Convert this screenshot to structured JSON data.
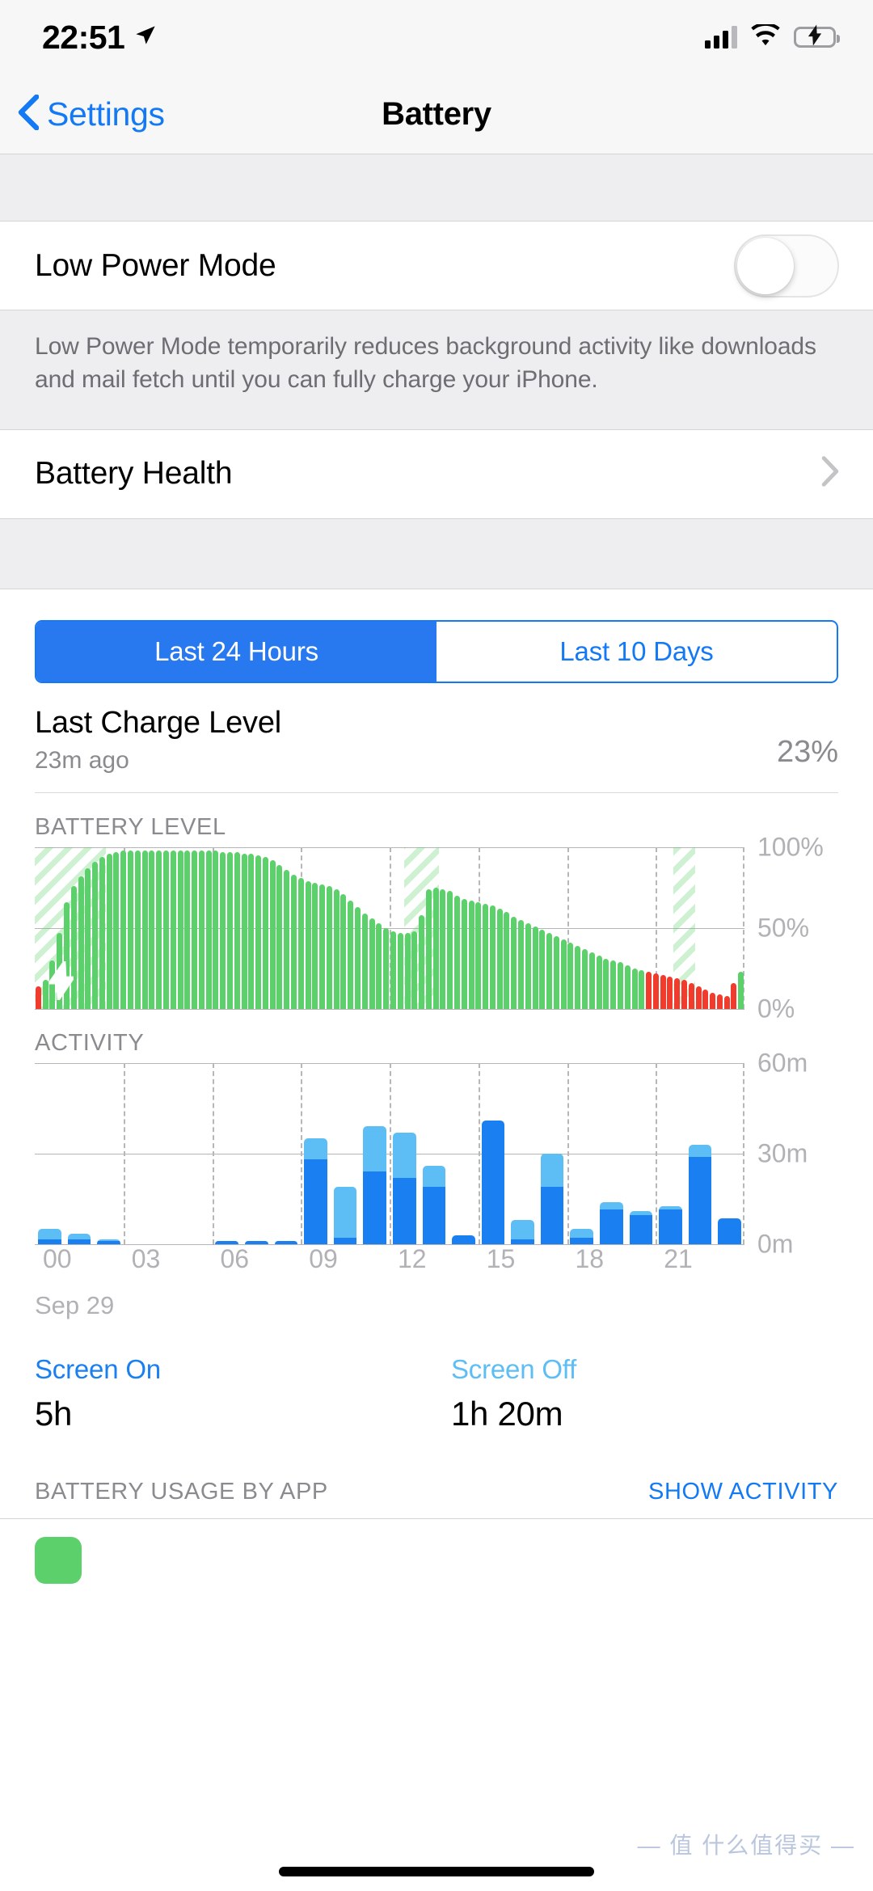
{
  "status_bar": {
    "time": "22:51",
    "location_icon": "location-arrow-icon",
    "cellular_icon": "cellular-bars-icon",
    "wifi_icon": "wifi-icon",
    "battery_icon": "battery-charging-icon"
  },
  "nav": {
    "back_label": "Settings",
    "back_icon": "chevron-left-icon",
    "title": "Battery"
  },
  "low_power": {
    "label": "Low Power Mode",
    "toggle_state": "off",
    "footer": "Low Power Mode temporarily reduces background activity like downloads and mail fetch until you can fully charge your iPhone."
  },
  "battery_health": {
    "label": "Battery Health",
    "disclosure_icon": "chevron-right-icon"
  },
  "segmented": {
    "options": [
      "Last 24 Hours",
      "Last 10 Days"
    ],
    "selected_index": 0
  },
  "last_charge": {
    "title": "Last Charge Level",
    "subtitle": "23m ago",
    "percent": "23%"
  },
  "legend": {
    "screen_on_label": "Screen On",
    "screen_on_value": "5h",
    "screen_off_label": "Screen Off",
    "screen_off_value": "1h 20m"
  },
  "bottom": {
    "usage_title": "BATTERY USAGE BY APP",
    "show_activity": "SHOW ACTIVITY"
  },
  "watermark": "— 值 什么值得买 —",
  "colors": {
    "accent_blue": "#1379f4",
    "segment_blue": "#2878f0",
    "battery_green": "#5cd06a",
    "battery_red": "#f03b2d",
    "screen_on_blue": "#1a7ff0",
    "screen_off_blue": "#5dbdf5",
    "grey_text": "#8a8a8f",
    "axis_label": "#b2b2b6"
  },
  "chart_data": [
    {
      "type": "bar",
      "name": "battery-level-chart",
      "title": "BATTERY LEVEL",
      "xlabel": "",
      "ylabel": "",
      "ylim": [
        0,
        100
      ],
      "ytick_labels": [
        "100%",
        "50%",
        "0%"
      ],
      "ytick_values": [
        100,
        50,
        0
      ],
      "grid": true,
      "x_range_hours": [
        0,
        24
      ],
      "charging_bands": [
        {
          "start_index": 0,
          "end_index": 9
        },
        {
          "start_index": 52,
          "end_index": 56
        },
        {
          "start_index": 90,
          "end_index": 92
        }
      ],
      "charging_bolt_index": 2,
      "bar_colors": {
        "normal": "#5cd06a",
        "low": "#f03b2d"
      },
      "values": [
        14,
        18,
        30,
        47,
        66,
        76,
        82,
        87,
        91,
        94,
        96,
        97,
        98,
        98,
        98,
        98,
        98,
        98,
        98,
        98,
        98,
        98,
        98,
        98,
        98,
        98,
        97,
        97,
        97,
        96,
        96,
        95,
        94,
        92,
        89,
        86,
        83,
        81,
        79,
        78,
        77,
        76,
        74,
        71,
        67,
        63,
        59,
        56,
        53,
        50,
        48,
        47,
        47,
        48,
        58,
        74,
        75,
        74,
        73,
        70,
        68,
        67,
        66,
        65,
        64,
        62,
        60,
        57,
        55,
        53,
        51,
        49,
        47,
        45,
        43,
        41,
        39,
        37,
        35,
        33,
        31,
        30,
        29,
        27,
        25,
        24,
        23,
        22,
        21,
        20,
        19,
        18,
        16,
        14,
        12,
        10,
        9,
        8,
        16,
        23
      ],
      "low_indices": [
        0,
        86,
        87,
        88,
        89,
        90,
        91,
        92,
        93,
        94,
        95,
        96,
        97,
        98
      ]
    },
    {
      "type": "bar",
      "name": "activity-chart",
      "title": "ACTIVITY",
      "stacked": true,
      "xlabel": "",
      "ylabel": "",
      "ylim": [
        0,
        60
      ],
      "ytick_labels": [
        "60m",
        "30m",
        "0m"
      ],
      "ytick_values": [
        60,
        30,
        0
      ],
      "grid": true,
      "date_label": "Sep 29",
      "xtick_labels": [
        "00",
        "03",
        "06",
        "09",
        "12",
        "15",
        "18",
        "21"
      ],
      "xtick_hours": [
        0,
        3,
        6,
        9,
        12,
        15,
        18,
        21
      ],
      "series": [
        {
          "name": "Screen On",
          "color": "#1a7ff0",
          "values": [
            1.5,
            1.5,
            1,
            0,
            0,
            0,
            1,
            1,
            1,
            28,
            2,
            24,
            22,
            19,
            3,
            41,
            1.5,
            19,
            2,
            11.5,
            9.5,
            11.5,
            29,
            8.5
          ]
        },
        {
          "name": "Screen Off",
          "color": "#5dbdf5",
          "values": [
            3.5,
            2,
            0.5,
            0,
            0,
            0,
            0,
            0,
            0,
            7,
            17,
            15,
            15,
            7,
            0,
            0,
            6.5,
            11,
            3,
            2.5,
            1.5,
            1,
            4,
            0
          ]
        }
      ],
      "hours": [
        0,
        1,
        2,
        3,
        4,
        5,
        6,
        7,
        8,
        9,
        10,
        11,
        12,
        13,
        14,
        15,
        16,
        17,
        18,
        19,
        20,
        21,
        22,
        23
      ]
    }
  ]
}
